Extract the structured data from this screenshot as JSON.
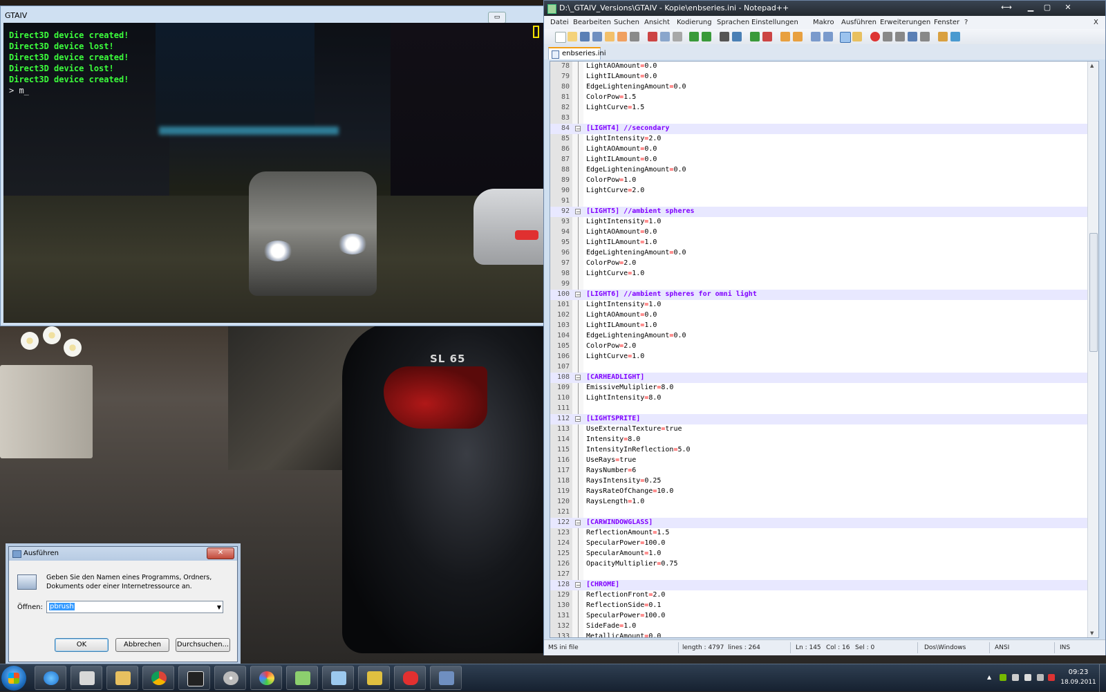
{
  "game_window": {
    "title": "GTAIV",
    "console_lines": [
      "Direct3D device created!",
      "Direct3D device lost!",
      "Direct3D device created!",
      "Direct3D device lost!",
      "Direct3D device created!"
    ],
    "console_prompt": " > m_"
  },
  "wallpaper": {
    "badge": "SL 65"
  },
  "notepad": {
    "title": "D:\\_GTAIV_Versions\\GTAIV - Kopie\\enbseries.ini - Notepad++",
    "menu": [
      "Datei",
      "Bearbeiten",
      "Suchen",
      "Ansicht",
      "Kodierung",
      "Sprachen",
      "Einstellungen",
      "Makro",
      "Ausführen",
      "Erweiterungen",
      "Fenster",
      "?"
    ],
    "close_doc_label": "X",
    "tab": "enbseries.ini",
    "lines": [
      {
        "n": "78",
        "text": "LightAOAmount=0.0"
      },
      {
        "n": "79",
        "text": "LightILAmount=0.0"
      },
      {
        "n": "80",
        "text": "EdgeLighteningAmount=0.0"
      },
      {
        "n": "81",
        "text": "ColorPow=1.5"
      },
      {
        "n": "82",
        "text": "LightCurve=1.5"
      },
      {
        "n": "83",
        "text": ""
      },
      {
        "n": "84",
        "text": "[LIGHT4] //secondary",
        "section": true
      },
      {
        "n": "85",
        "text": "LightIntensity=2.0"
      },
      {
        "n": "86",
        "text": "LightAOAmount=0.0"
      },
      {
        "n": "87",
        "text": "LightILAmount=0.0"
      },
      {
        "n": "88",
        "text": "EdgeLighteningAmount=0.0"
      },
      {
        "n": "89",
        "text": "ColorPow=1.0"
      },
      {
        "n": "90",
        "text": "LightCurve=2.0"
      },
      {
        "n": "91",
        "text": ""
      },
      {
        "n": "92",
        "text": "[LIGHT5] //ambient spheres",
        "section": true
      },
      {
        "n": "93",
        "text": "LightIntensity=1.0"
      },
      {
        "n": "94",
        "text": "LightAOAmount=0.0"
      },
      {
        "n": "95",
        "text": "LightILAmount=1.0"
      },
      {
        "n": "96",
        "text": "EdgeLighteningAmount=0.0"
      },
      {
        "n": "97",
        "text": "ColorPow=2.0"
      },
      {
        "n": "98",
        "text": "LightCurve=1.0"
      },
      {
        "n": "99",
        "text": ""
      },
      {
        "n": "100",
        "text": "[LIGHT6] //ambient spheres for omni light",
        "section": true
      },
      {
        "n": "101",
        "text": "LightIntensity=1.0"
      },
      {
        "n": "102",
        "text": "LightAOAmount=0.0"
      },
      {
        "n": "103",
        "text": "LightILAmount=1.0"
      },
      {
        "n": "104",
        "text": "EdgeLighteningAmount=0.0"
      },
      {
        "n": "105",
        "text": "ColorPow=2.0"
      },
      {
        "n": "106",
        "text": "LightCurve=1.0"
      },
      {
        "n": "107",
        "text": ""
      },
      {
        "n": "108",
        "text": "[CARHEADLIGHT]",
        "section": true
      },
      {
        "n": "109",
        "text": "EmissiveMuliplier=8.0"
      },
      {
        "n": "110",
        "text": "LightIntensity=8.0"
      },
      {
        "n": "111",
        "text": ""
      },
      {
        "n": "112",
        "text": "[LIGHTSPRITE]",
        "section": true
      },
      {
        "n": "113",
        "text": "UseExternalTexture=true"
      },
      {
        "n": "114",
        "text": "Intensity=8.0"
      },
      {
        "n": "115",
        "text": "IntensityInReflection=5.0"
      },
      {
        "n": "116",
        "text": "UseRays=true"
      },
      {
        "n": "117",
        "text": "RaysNumber=6"
      },
      {
        "n": "118",
        "text": "RaysIntensity=0.25"
      },
      {
        "n": "119",
        "text": "RaysRateOfChange=10.0"
      },
      {
        "n": "120",
        "text": "RaysLength=1.0"
      },
      {
        "n": "121",
        "text": ""
      },
      {
        "n": "122",
        "text": "[CARWINDOWGLASS]",
        "section": true
      },
      {
        "n": "123",
        "text": "ReflectionAmount=1.5"
      },
      {
        "n": "124",
        "text": "SpecularPower=100.0"
      },
      {
        "n": "125",
        "text": "SpecularAmount=1.0"
      },
      {
        "n": "126",
        "text": "OpacityMultiplier=0.75"
      },
      {
        "n": "127",
        "text": ""
      },
      {
        "n": "128",
        "text": "[CHROME]",
        "section": true
      },
      {
        "n": "129",
        "text": "ReflectionFront=2.0"
      },
      {
        "n": "130",
        "text": "ReflectionSide=0.1"
      },
      {
        "n": "131",
        "text": "SpecularPower=100.0"
      },
      {
        "n": "132",
        "text": "SideFade=1.0"
      },
      {
        "n": "133",
        "text": "MetallicAmount=0.0"
      }
    ],
    "status": {
      "filetype": "MS ini file",
      "length": "length : 4797",
      "lines": "lines : 264",
      "ln": "Ln : 145",
      "col": "Col : 16",
      "sel": "Sel : 0",
      "eol": "Dos\\Windows",
      "encoding": "ANSI",
      "mode": "INS"
    }
  },
  "run_dialog": {
    "title": "Ausführen",
    "description": "Geben Sie den Namen eines Programms, Ordners, Dokuments oder einer Internetressource an.",
    "open_label": "Öffnen:",
    "input_value": "pbrush",
    "ok": "OK",
    "cancel": "Abbrechen",
    "browse": "Durchsuchen..."
  },
  "taskbar": {
    "time": "09:23",
    "date": "18.09.2011",
    "pinned": [
      "internet-explorer",
      "gta-iv",
      "file-explorer",
      "chrome",
      "gta-iv-icon",
      "disc",
      "paint-palette",
      "notepad-plus-plus",
      "pen-tool",
      "game-launcher",
      "paint-splash",
      "window"
    ]
  }
}
